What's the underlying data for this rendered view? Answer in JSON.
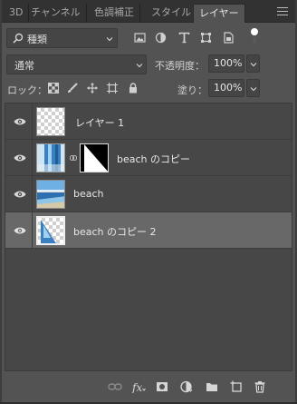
{
  "tabs": [
    {
      "label": "3D",
      "active": false
    },
    {
      "label": "チャンネル",
      "active": false
    },
    {
      "label": "色調補正",
      "active": false
    },
    {
      "label": "スタイル",
      "active": false
    },
    {
      "label": "レイヤー",
      "active": true
    }
  ],
  "filter": {
    "label": "種類"
  },
  "blend": {
    "mode": "通常",
    "opacity_label": "不透明度：",
    "opacity_value": "100%"
  },
  "lock": {
    "label": "ロック：",
    "fill_label": "塗り：",
    "fill_value": "100%"
  },
  "layers": [
    {
      "name": "レイヤー 1",
      "visible": true,
      "selected": false
    },
    {
      "name": "beach のコピー",
      "visible": true,
      "selected": false
    },
    {
      "name": "beach",
      "visible": true,
      "selected": false
    },
    {
      "name": "beach のコピー 2",
      "visible": true,
      "selected": true
    }
  ],
  "colors": {
    "panel_bg": "#535353",
    "list_bg": "#474747",
    "selected_row": "#686868",
    "tab_bar": "#323232"
  }
}
